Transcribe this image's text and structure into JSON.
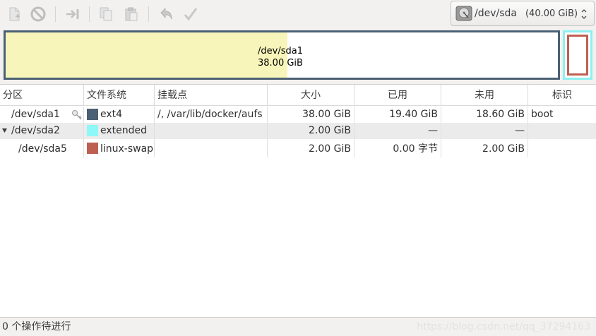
{
  "toolbar": {
    "buttons": [
      {
        "name": "new-partition",
        "icon": "new-document-icon"
      },
      {
        "name": "delete-partition",
        "icon": "no-entry-icon"
      },
      {
        "name": "resize-move",
        "icon": "arrow-to-bar-icon"
      },
      {
        "name": "copy",
        "icon": "copy-icon"
      },
      {
        "name": "paste",
        "icon": "paste-icon"
      },
      {
        "name": "undo",
        "icon": "undo-arrow-icon"
      },
      {
        "name": "apply",
        "icon": "checkmark-icon"
      }
    ],
    "device": {
      "name": "/dev/sda",
      "size": "(40.00 GiB)"
    }
  },
  "graph": {
    "sda1_name": "/dev/sda1",
    "sda1_size": "38.00 GiB",
    "sda1_used_fraction": 0.51
  },
  "table": {
    "headers": [
      "分区",
      "文件系统",
      "挂载点",
      "大小",
      "已用",
      "未用",
      "标识"
    ],
    "rows": [
      {
        "partition": "/dev/sda1",
        "fs": "ext4",
        "fs_color": "#4a6074",
        "mount": "/, /var/lib/docker/aufs",
        "size": "38.00 GiB",
        "used": "19.40 GiB",
        "unused": "18.60 GiB",
        "flags": "boot",
        "key_icon": true
      },
      {
        "partition": "/dev/sda2",
        "fs": "extended",
        "fs_color": "#8ef8f8",
        "mount": "",
        "size": "2.00 GiB",
        "used": "—",
        "unused": "—",
        "flags": "",
        "expander": true
      },
      {
        "partition": "/dev/sda5",
        "fs": "linux-swap",
        "fs_color": "#bf5f52",
        "mount": "",
        "size": "2.00 GiB",
        "used": "0.00 字节",
        "unused": "2.00 GiB",
        "flags": ""
      }
    ]
  },
  "status": {
    "text": "0 个操作待进行",
    "watermark": "https://blog.csdn.net/qq_37294163"
  }
}
